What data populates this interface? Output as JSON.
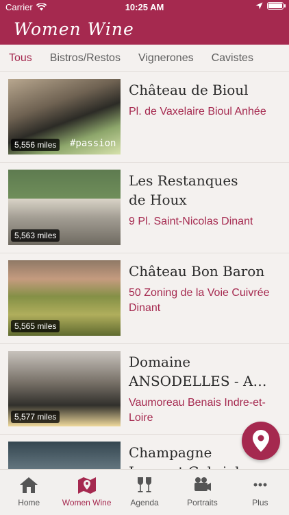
{
  "status_bar": {
    "carrier": "Carrier",
    "time": "10:25 AM"
  },
  "app": {
    "title": "Women Wine",
    "accent": "#a5294f"
  },
  "tabs": [
    {
      "label": "Tous",
      "active": true
    },
    {
      "label": "Bistros/Restos",
      "active": false
    },
    {
      "label": "Vignerones",
      "active": false
    },
    {
      "label": "Cavistes",
      "active": false
    }
  ],
  "venues": [
    {
      "name": "Château de Bioul",
      "address": "Pl. de Vaxelaire Bioul Anhée",
      "distance": "5,556 miles",
      "image_text": "#passion"
    },
    {
      "name": "Les Restanques\nde Houx",
      "address": "9 Pl. Saint-Nicolas Dinant",
      "distance": "5,563 miles"
    },
    {
      "name": "Château Bon Baron",
      "address": "50 Zoning de la Voie Cuivrée Dinant",
      "distance": "5,565 miles"
    },
    {
      "name": "Domaine\nANSODELLES - A…",
      "address": "Vaumoreau Benais Indre-et-Loire",
      "distance": "5,577 miles"
    },
    {
      "name": "Champagne\nLaurent Gabriel",
      "address": "",
      "distance": ""
    }
  ],
  "tabbar": [
    {
      "label": "Home",
      "icon": "home-icon",
      "active": false
    },
    {
      "label": "Women Wine",
      "icon": "map-icon",
      "active": true
    },
    {
      "label": "Agenda",
      "icon": "wine-glasses-icon",
      "active": false
    },
    {
      "label": "Portraits",
      "icon": "video-camera-icon",
      "active": false
    },
    {
      "label": "Plus",
      "icon": "more-icon",
      "active": false
    }
  ]
}
